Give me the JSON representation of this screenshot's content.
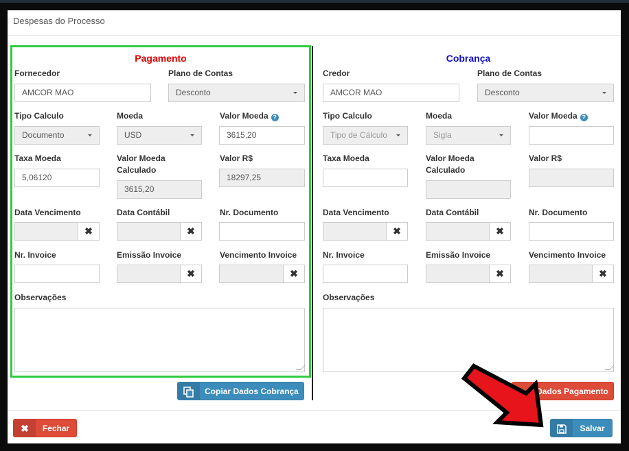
{
  "modal": {
    "title": "Despesas do Processo"
  },
  "pagamento": {
    "title": "Pagamento",
    "fornecedor_label": "Fornecedor",
    "fornecedor_value": "AMCOR MAO",
    "plano_label": "Plano de Contas",
    "plano_value": "Desconto",
    "tipo_calculo_label": "Tipo Calculo",
    "tipo_calculo_value": "Documento",
    "moeda_label": "Moeda",
    "moeda_value": "USD",
    "valor_moeda_label": "Valor Moeda",
    "valor_moeda_value": "3615,20",
    "taxa_moeda_label": "Taxa Moeda",
    "taxa_moeda_value": "5,06120",
    "valor_moeda_calc_label_1": "Valor Moeda",
    "valor_moeda_calc_label_2": "Calculado",
    "valor_moeda_calc_value": "3615,20",
    "valor_rs_label": "Valor R$",
    "valor_rs_value": "18297,25",
    "data_venc_label": "Data Vencimento",
    "data_contabil_label": "Data Contábil",
    "nr_documento_label": "Nr. Documento",
    "nr_invoice_label": "Nr. Invoice",
    "emissao_invoice_label": "Emissão Invoice",
    "venc_invoice_label": "Vencimento Invoice",
    "observacoes_label": "Observações",
    "copy_button_label": "Copiar Dados Cobrança"
  },
  "cobranca": {
    "title": "Cobrança",
    "credor_label": "Credor",
    "credor_value": "AMCOR MAO",
    "plano_label": "Plano de Contas",
    "plano_value": "Desconto",
    "tipo_calculo_label": "Tipo Calculo",
    "tipo_calculo_value": "Tipo de Cálculo",
    "moeda_label": "Moeda",
    "moeda_value": "Sigla",
    "valor_moeda_label": "Valor Moeda",
    "taxa_moeda_label": "Taxa Moeda",
    "valor_moeda_calc_label_1": "Valor Moeda",
    "valor_moeda_calc_label_2": "Calculado",
    "valor_rs_label": "Valor R$",
    "data_venc_label": "Data Vencimento",
    "data_contabil_label": "Data Contábil",
    "nr_documento_label": "Nr. Documento",
    "nr_invoice_label": "Nr. Invoice",
    "emissao_invoice_label": "Emissão Invoice",
    "venc_invoice_label": "Vencimento Invoice",
    "observacoes_label": "Observações",
    "copy_button_label": "r Dados Pagamento"
  },
  "footer": {
    "fechar_label": "Fechar",
    "salvar_label": "Salvar"
  },
  "colors": {
    "pagamento_title": "#e00000",
    "cobranca_title": "#1010c0",
    "highlight": "#2ecc40",
    "arrow": "#e8141c"
  }
}
